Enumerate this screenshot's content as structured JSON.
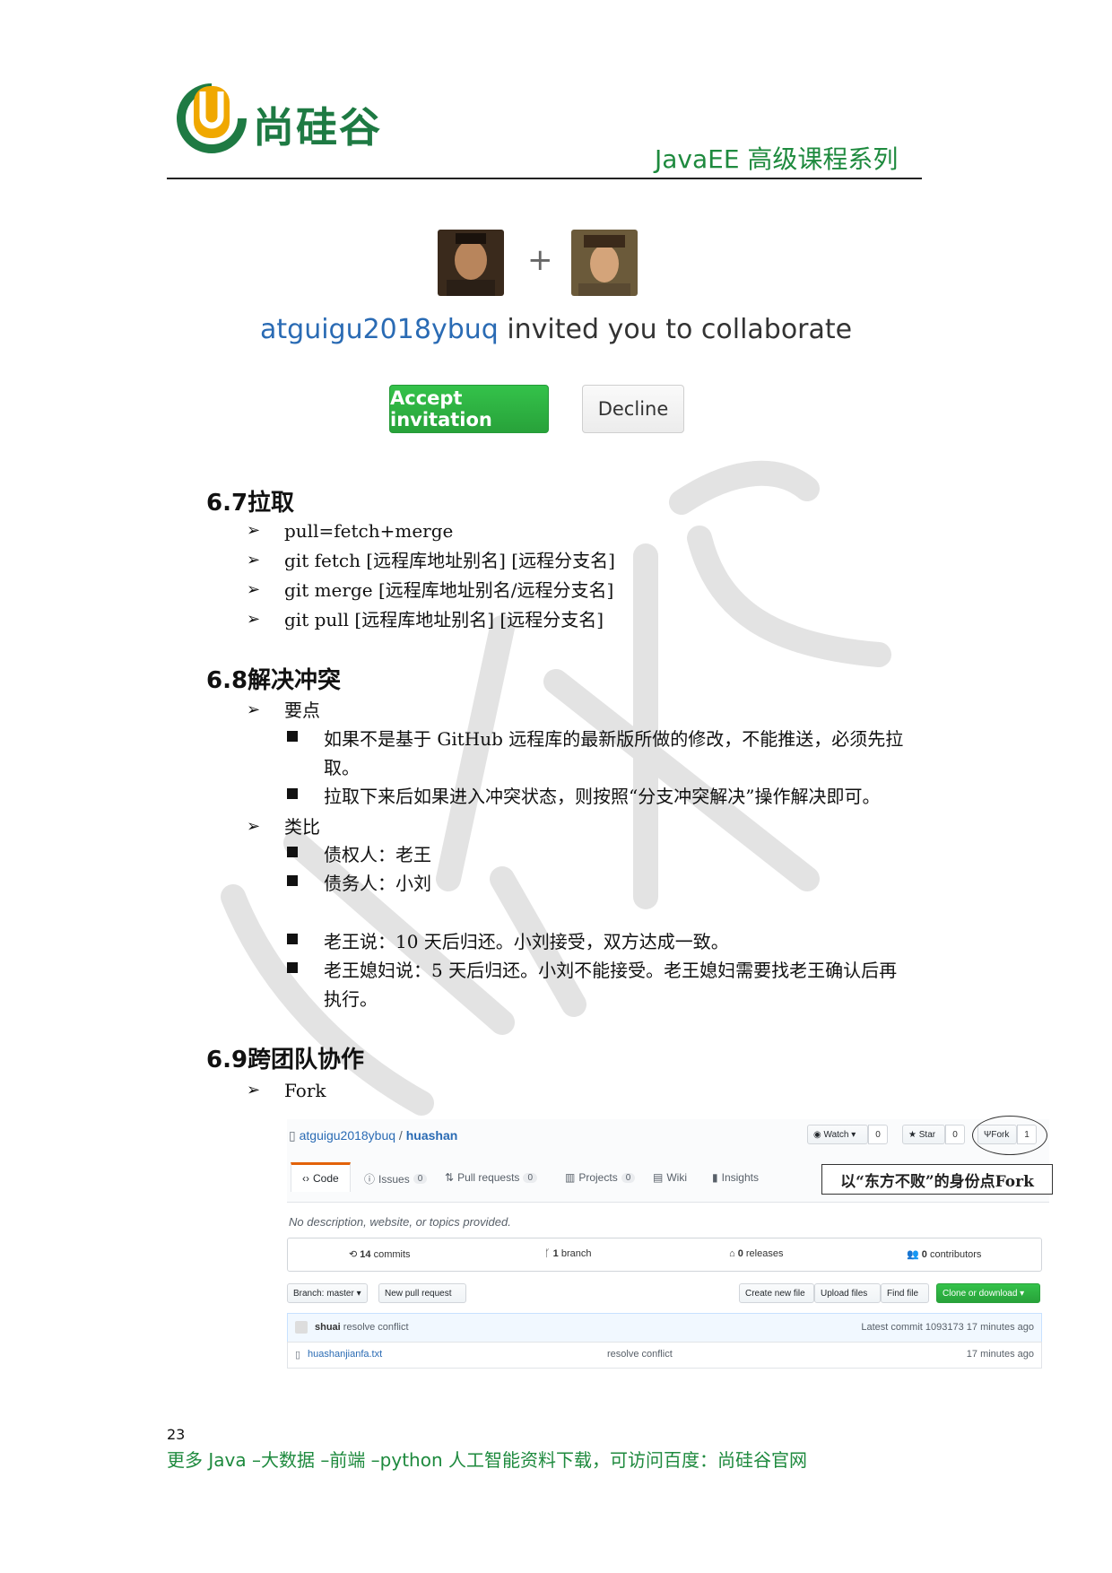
{
  "header": {
    "logo_text": "尚硅谷",
    "series_title": "JavaEE 高级课程系列"
  },
  "invitation": {
    "inviter": "atguigu2018ybuq",
    "message": " invited you to collaborate",
    "plus": "+",
    "accept_label": "Accept invitation",
    "decline_label": "Decline"
  },
  "sections": {
    "s67": {
      "title": "6.7拉取",
      "items": [
        "pull=fetch+merge",
        "git fetch [远程库地址别名] [远程分支名]",
        "git merge [远程库地址别名/远程分支名]",
        "git pull [远程库地址别名] [远程分支名]"
      ]
    },
    "s68": {
      "title": "6.8解决冲突",
      "point_label": "要点",
      "point_1a": "如果不是基于 GitHub 远程库的最新版所做的修改，不能推送，必须先拉",
      "point_1b": "取。",
      "point_2": "拉取下来后如果进入冲突状态，则按照“分支冲突解决”操作解决即可。",
      "analogy_label": "类比",
      "analogy_1": "债权人：老王",
      "analogy_2": "债务人：小刘",
      "analogy_3": "老王说：10 天后归还。小刘接受，双方达成一致。",
      "analogy_4a": "老王媳妇说：5 天后归还。小刘不能接受。老王媳妇需要找老王确认后再",
      "analogy_4b": "执行。"
    },
    "s69": {
      "title": "6.9跨团队协作",
      "item": "Fork"
    }
  },
  "github": {
    "owner": "atguigu2018ybuq",
    "slash": " / ",
    "repo": "huashan",
    "watch_label": "Watch ▾",
    "watch_count": "0",
    "star_label": "Star",
    "star_count": "0",
    "fork_label": "Fork",
    "fork_count": "1",
    "tabs": {
      "code": "Code",
      "issues": "Issues",
      "issues_count": "0",
      "pulls": "Pull requests",
      "pulls_count": "0",
      "projects": "Projects",
      "projects_count": "0",
      "wiki": "Wiki",
      "insights": "Insights"
    },
    "annotation": "以“东方不败”的身份点Fork",
    "description": "No description, website, or topics provided.",
    "stats": {
      "commits_num": "14",
      "commits_label": " commits",
      "branch_num": "1",
      "branch_label": " branch",
      "releases_num": "0",
      "releases_label": " releases",
      "contributors_num": "0",
      "contributors_label": " contributors"
    },
    "branch_button": "Branch: master ▾",
    "new_pr_button": "New pull request",
    "create_file": "Create new file",
    "upload_files": "Upload files",
    "find_file": "Find file",
    "clone_button": "Clone or download ▾",
    "commit_author": "shuai",
    "commit_message": " resolve conflict",
    "latest_commit": "Latest commit 1093173 17 minutes ago",
    "file_name": "huashanjianfa.txt",
    "file_commit": "resolve conflict",
    "file_age": "17 minutes ago"
  },
  "footer": {
    "page_number": "23",
    "note": "更多 Java –大数据 –前端 –python 人工智能资料下载，可访问百度：尚硅谷官网"
  }
}
